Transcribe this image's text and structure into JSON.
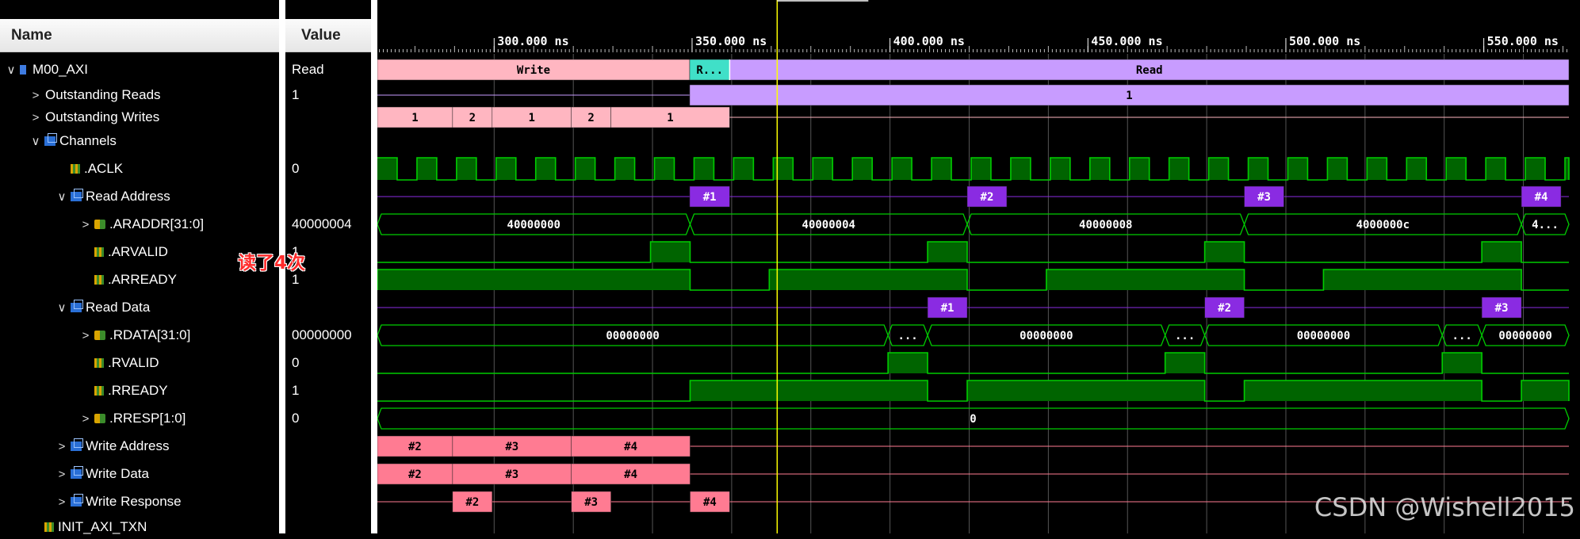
{
  "columns": {
    "name": "Name",
    "value": "Value"
  },
  "rows": [
    {
      "label": "M00_AXI",
      "value": "Read",
      "indent": 0,
      "chevron": "∨",
      "icon": "interface"
    },
    {
      "label": "Outstanding Reads",
      "value": "1",
      "indent": 1,
      "chevron": ">",
      "icon": ""
    },
    {
      "label": "Outstanding Writes",
      "value": "",
      "indent": 1,
      "chevron": ">",
      "icon": ""
    },
    {
      "label": "Channels",
      "value": "",
      "indent": 1,
      "chevron": "∨",
      "icon": "group"
    },
    {
      "label": ".ACLK",
      "value": "0",
      "indent": 2,
      "chevron": "",
      "icon": "signal"
    },
    {
      "label": "Read Address",
      "value": "",
      "indent": 2,
      "chevron": "∨",
      "icon": "group"
    },
    {
      "label": ".ARADDR[31:0]",
      "value": "40000004",
      "indent": 3,
      "chevron": ">",
      "icon": "bus"
    },
    {
      "label": ".ARVALID",
      "value": "1",
      "indent": 3,
      "chevron": "",
      "icon": "signal"
    },
    {
      "label": ".ARREADY",
      "value": "1",
      "indent": 3,
      "chevron": "",
      "icon": "signal"
    },
    {
      "label": "Read Data",
      "value": "",
      "indent": 2,
      "chevron": "∨",
      "icon": "group"
    },
    {
      "label": ".RDATA[31:0]",
      "value": "00000000",
      "indent": 3,
      "chevron": ">",
      "icon": "bus"
    },
    {
      "label": ".RVALID",
      "value": "0",
      "indent": 3,
      "chevron": "",
      "icon": "signal"
    },
    {
      "label": ".RREADY",
      "value": "1",
      "indent": 3,
      "chevron": "",
      "icon": "signal"
    },
    {
      "label": ".RRESP[1:0]",
      "value": "0",
      "indent": 3,
      "chevron": ">",
      "icon": "bus"
    },
    {
      "label": "Write Address",
      "value": "",
      "indent": 2,
      "chevron": ">",
      "icon": "group"
    },
    {
      "label": "Write Data",
      "value": "",
      "indent": 2,
      "chevron": ">",
      "icon": "group"
    },
    {
      "label": "Write Response",
      "value": "",
      "indent": 2,
      "chevron": ">",
      "icon": "group"
    },
    {
      "label": "INIT_AXI_TXN",
      "value": "",
      "indent": 1,
      "chevron": "",
      "icon": "signal"
    }
  ],
  "timeline": {
    "unit": "ns",
    "range_ns": [
      270.5,
      571.5
    ],
    "major_ticks": [
      {
        "t": 300,
        "label": "300.000 ns"
      },
      {
        "t": 350,
        "label": "350.000 ns"
      },
      {
        "t": 400,
        "label": "400.000 ns"
      },
      {
        "t": 450,
        "label": "450.000 ns"
      },
      {
        "t": 500,
        "label": "500.000 ns"
      },
      {
        "t": 550,
        "label": "550.000 ns"
      }
    ],
    "cursor_ns": 371.5,
    "clock_period_ns": 10,
    "clock_first_rise_ns": 270.5
  },
  "waves": {
    "state": [
      {
        "from": 270.5,
        "to": 349.4,
        "label": "Write",
        "color": "#ffb6c1"
      },
      {
        "from": 349.4,
        "to": 359.5,
        "label": "R...",
        "color": "#40e0c8"
      },
      {
        "from": 359.5,
        "to": 571.5,
        "label": "Read",
        "color": "#c89cff"
      }
    ],
    "outstanding_reads": [
      {
        "from": 349.4,
        "to": 571.5,
        "label": "1",
        "color": "#c89cff"
      }
    ],
    "outstanding_writes": [
      {
        "from": 270.5,
        "to": 289.5,
        "label": "1",
        "color": "#ffb6c1"
      },
      {
        "from": 289.5,
        "to": 299.5,
        "label": "2",
        "color": "#ffb6c1"
      },
      {
        "from": 299.5,
        "to": 319.5,
        "label": "1",
        "color": "#ffb6c1"
      },
      {
        "from": 319.5,
        "to": 329.5,
        "label": "2",
        "color": "#ffb6c1"
      },
      {
        "from": 329.5,
        "to": 359.5,
        "label": "1",
        "color": "#ffb6c1"
      }
    ],
    "read_addr_tx": [
      {
        "from": 349.4,
        "to": 359.5,
        "label": "#1"
      },
      {
        "from": 419.5,
        "to": 429.5,
        "label": "#2"
      },
      {
        "from": 489.5,
        "to": 499.5,
        "label": "#3"
      },
      {
        "from": 559.5,
        "to": 569.5,
        "label": "#4"
      }
    ],
    "araddr": [
      {
        "from": 270.5,
        "to": 349.5,
        "label": "40000000"
      },
      {
        "from": 349.5,
        "to": 419.5,
        "label": "40000004"
      },
      {
        "from": 419.5,
        "to": 489.5,
        "label": "40000008"
      },
      {
        "from": 489.5,
        "to": 559.5,
        "label": "4000000c"
      },
      {
        "from": 559.5,
        "to": 571.5,
        "label": "4..."
      }
    ],
    "arvalid": [
      [
        339.5,
        349.5
      ],
      [
        409.5,
        419.5
      ],
      [
        479.5,
        489.5
      ],
      [
        549.5,
        559.5
      ]
    ],
    "arready": [
      [
        270.5,
        349.5
      ],
      [
        369.5,
        419.5
      ],
      [
        439.5,
        489.5
      ],
      [
        509.5,
        559.5
      ]
    ],
    "read_data_tx": [
      {
        "from": 409.5,
        "to": 419.5,
        "label": "#1"
      },
      {
        "from": 479.5,
        "to": 489.5,
        "label": "#2"
      },
      {
        "from": 549.5,
        "to": 559.5,
        "label": "#3"
      }
    ],
    "rdata": [
      {
        "from": 270.5,
        "to": 399.5,
        "label": "00000000"
      },
      {
        "from": 399.5,
        "to": 409.5,
        "label": "..."
      },
      {
        "from": 409.5,
        "to": 469.5,
        "label": "00000000"
      },
      {
        "from": 469.5,
        "to": 479.5,
        "label": "..."
      },
      {
        "from": 479.5,
        "to": 539.5,
        "label": "00000000"
      },
      {
        "from": 539.5,
        "to": 549.5,
        "label": "..."
      },
      {
        "from": 549.5,
        "to": 571.5,
        "label": "00000000"
      }
    ],
    "rvalid": [
      [
        399.5,
        409.5
      ],
      [
        469.5,
        479.5
      ],
      [
        539.5,
        549.5
      ]
    ],
    "rready": [
      [
        349.5,
        409.5
      ],
      [
        419.5,
        479.5
      ],
      [
        489.5,
        549.5
      ],
      [
        559.5,
        571.5
      ]
    ],
    "rresp": [
      {
        "from": 270.5,
        "to": 571.5,
        "label": "0"
      }
    ],
    "write_address": [
      {
        "from": 270.5,
        "to": 289.5,
        "label": "#2"
      },
      {
        "from": 289.5,
        "to": 319.5,
        "label": "#3"
      },
      {
        "from": 319.5,
        "to": 349.5,
        "label": "#4"
      }
    ],
    "write_data": [
      {
        "from": 270.5,
        "to": 289.5,
        "label": "#2"
      },
      {
        "from": 289.5,
        "to": 319.5,
        "label": "#3"
      },
      {
        "from": 319.5,
        "to": 349.5,
        "label": "#4"
      }
    ],
    "write_response": [
      {
        "from": 289.5,
        "to": 299.5,
        "label": "#2"
      },
      {
        "from": 319.5,
        "to": 329.5,
        "label": "#3"
      },
      {
        "from": 349.5,
        "to": 359.5,
        "label": "#4"
      }
    ]
  },
  "colors": {
    "signal": "#00cc00",
    "signal_fill": "#006400",
    "transaction": "#8a2be2",
    "write_tx": "#ff7b92",
    "cursor": "#ffff00",
    "grid": "#555555"
  },
  "annotation": "读了4次",
  "watermark": "CSDN @Wishell2015"
}
